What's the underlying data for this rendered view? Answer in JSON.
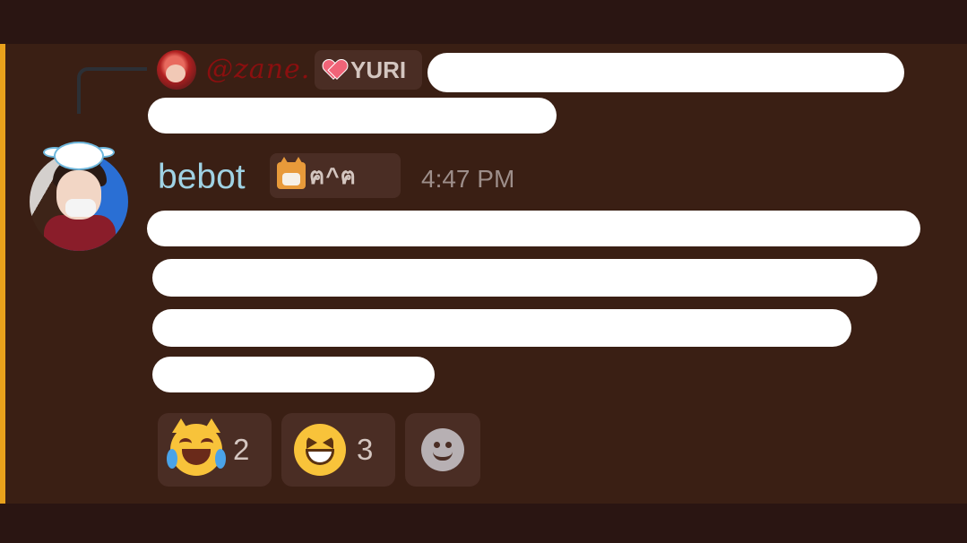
{
  "reply": {
    "username": "@zane.",
    "tag_label": "YURI",
    "tag_icon": "heart-icon"
  },
  "message": {
    "username": "bebot",
    "tag_label": "ฅ^ฅ",
    "tag_icon": "cat-icon",
    "timestamp": "4:47 PM"
  },
  "reactions": [
    {
      "emoji": "crying-laughing-cat-emoji",
      "count": "2"
    },
    {
      "emoji": "laughing-emoji",
      "count": "3"
    }
  ],
  "colors": {
    "mention_accent": "#e8a11c",
    "reply_username": "#8b0f0f",
    "username": "#9fd2e4"
  }
}
